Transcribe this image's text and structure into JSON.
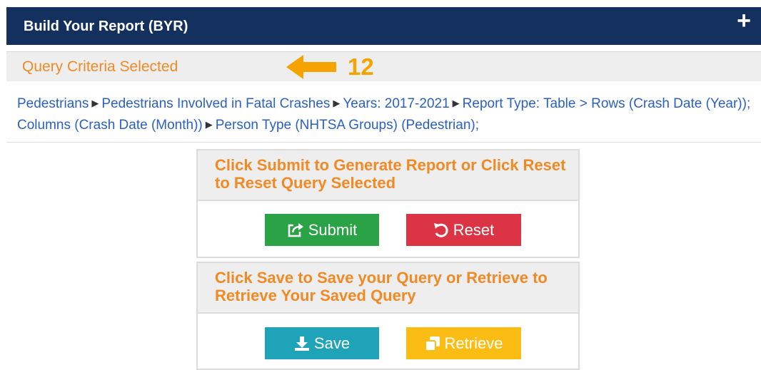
{
  "header": {
    "title": "Build Your Report (BYR)",
    "expand_symbol": "+"
  },
  "criteria": {
    "title": "Query Criteria Selected",
    "callout_number": "12"
  },
  "breadcrumb": {
    "items": [
      "Pedestrians",
      "Pedestrians Involved in Fatal Crashes",
      "Years: 2017-2021",
      "Report Type: Table > Rows (Crash Date (Year)); Columns (Crash Date (Month))",
      "Person Type (NHTSA Groups) (Pedestrian);"
    ]
  },
  "submit_panel": {
    "heading": "Click Submit to Generate Report or Click Reset to Reset Query Selected",
    "submit_label": "Submit",
    "reset_label": "Reset"
  },
  "save_panel": {
    "heading": "Click Save to Save your Query or Retrieve to Retrieve Your Saved Query",
    "save_label": "Save",
    "retrieve_label": "Retrieve"
  },
  "icons": {
    "expand": "plus-icon",
    "callout": "arrow-left-icon",
    "separator": "triangle-right-icon",
    "submit": "share-square-icon",
    "reset": "undo-icon",
    "save": "download-icon",
    "retrieve": "copy-icon"
  },
  "colors": {
    "header_bg": "#14305e",
    "accent_orange": "#f08a24",
    "link_blue": "#2a5fc4",
    "submit": "#2aa246",
    "reset": "#db3545",
    "save": "#1ea3b8",
    "retrieve": "#fbbd14"
  }
}
